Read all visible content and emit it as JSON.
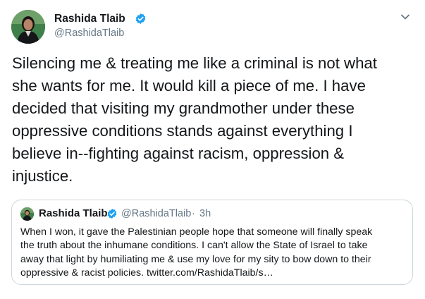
{
  "tweet": {
    "author": {
      "name": "Rashida Tlaib",
      "handle": "@RashidaTlaib",
      "verified": true,
      "avatar_icon": "profile-photo"
    },
    "text": "Silencing me & treating me like a criminal is not what\nshe wants for me. It would kill a piece of me. I have\ndecided that visiting my grandmother under these\noppressive conditions stands against everything I\nbelieve in--fighting against racism, oppression &\ninjustice.",
    "menu_icon": "chevron-down-icon"
  },
  "quoted_tweet": {
    "author": {
      "name": "Rashida Tlaib",
      "handle": "@RashidaTlaib",
      "verified": true
    },
    "separator": "·",
    "time": "3h",
    "text": "When I won, it gave the Palestinian people hope that someone will finally speak\nthe truth about the inhumane conditions. I can't allow the State of Israel to take\naway that light by humiliating me & use my love for my sity to bow down to their\noppressive & racist policies. twitter.com/RashidaTlaib/s…"
  },
  "colors": {
    "text": "#14171a",
    "secondary_text": "#657786",
    "verified_badge": "#1da1f2",
    "border": "#ccd6dd",
    "background": "#ffffff"
  }
}
